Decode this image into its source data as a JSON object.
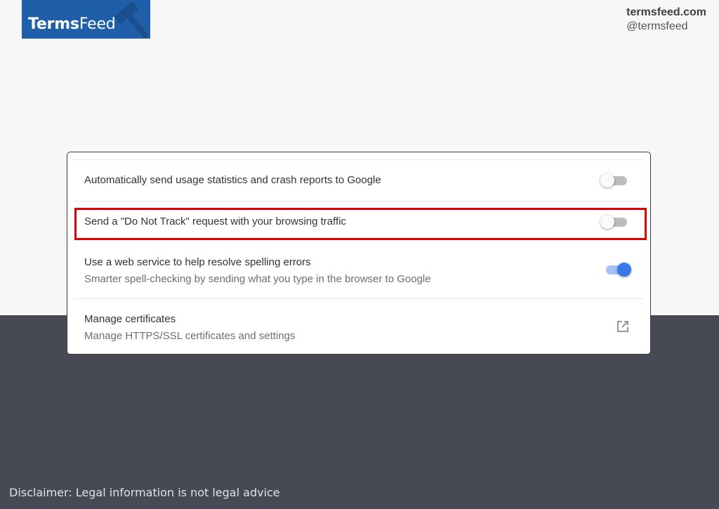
{
  "header": {
    "logo": {
      "terms": "Terms",
      "feed": "Feed",
      "bg_color": "#1f5fa9"
    },
    "brand": {
      "domain": "termsfeed.com",
      "handle": "@termsfeed"
    }
  },
  "settings": {
    "rows": [
      {
        "label": "Automatically send usage statistics and crash reports to Google",
        "control": "toggle",
        "state": "off"
      },
      {
        "label": "Send a \"Do Not Track\" request with your browsing traffic",
        "control": "toggle",
        "state": "off",
        "highlighted": true
      },
      {
        "label": "Use a web service to help resolve spelling errors",
        "sublabel": "Smarter spell-checking by sending what you type in the browser to Google",
        "control": "toggle",
        "state": "on"
      },
      {
        "label": "Manage certificates",
        "sublabel": "Manage HTTPS/SSL certificates and settings",
        "control": "external-link-icon"
      }
    ]
  },
  "footer": {
    "disclaimer": "Disclaimer: Legal information is not legal advice"
  },
  "colors": {
    "accent": "#3b78e7",
    "highlight": "#e00000",
    "dark_bg": "#474a54"
  }
}
